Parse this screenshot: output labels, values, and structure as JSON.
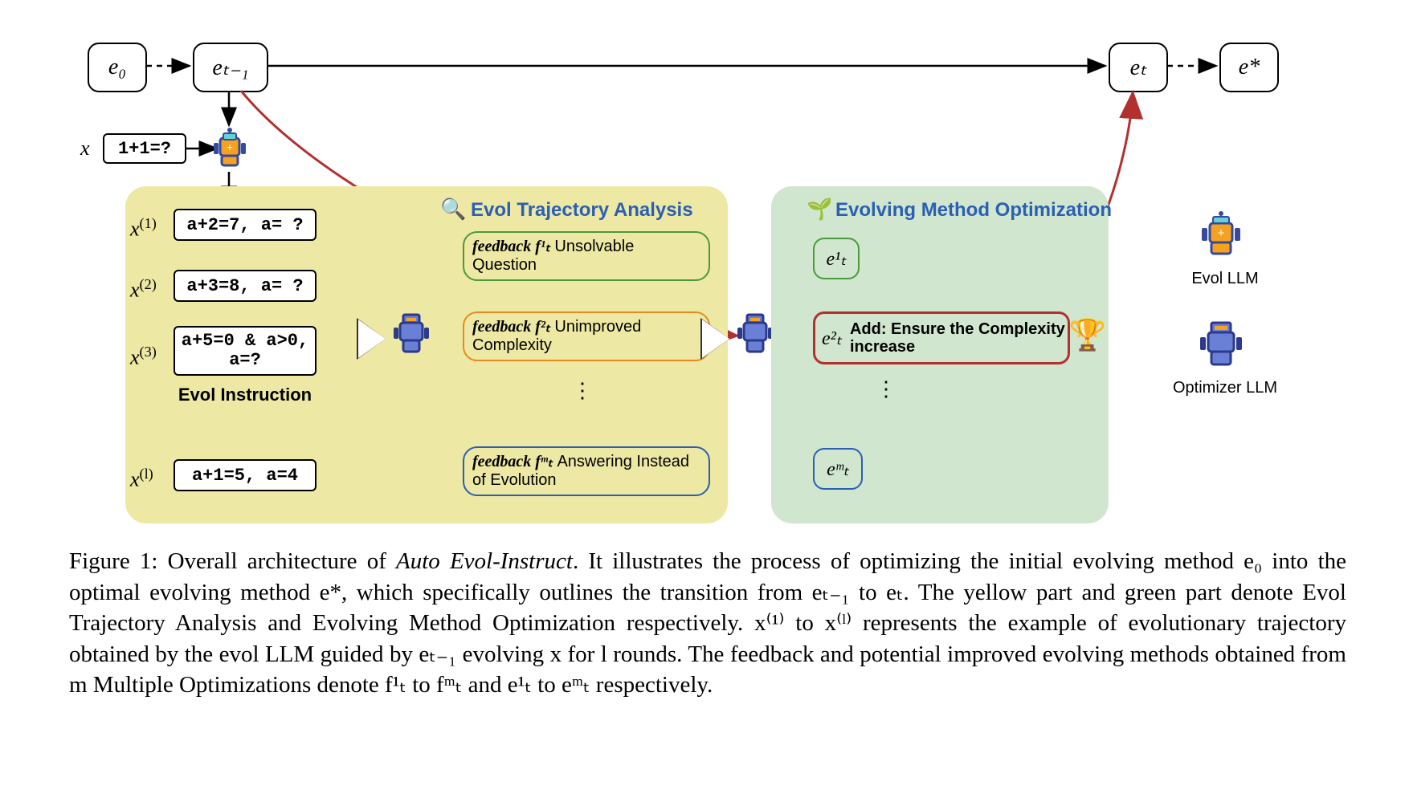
{
  "top_nodes": {
    "e0": "e₀",
    "etm1": "eₜ₋₁",
    "et": "eₜ",
    "estar": "e*"
  },
  "x_label": "x",
  "x_input": "1+1=?",
  "traj": {
    "x1": {
      "lab": "x⁽¹⁾",
      "val": "a+2=7, a= ?"
    },
    "x2": {
      "lab": "x⁽²⁾",
      "val": "a+3=8, a= ?"
    },
    "x3": {
      "lab": "x⁽³⁾",
      "val": "a+5=0 & a>0, a=?"
    },
    "xl": {
      "lab": "x⁽ˡ⁾",
      "val": "a+1=5, a=4"
    },
    "midtext": "Evol Instruction"
  },
  "panel1_title": "Evol Trajectory Analysis",
  "panel2_title": "Evolving Method Optimization",
  "feedback": {
    "f1": {
      "lab": "feedback f¹ₜ",
      "txt": "Unsolvable Question"
    },
    "f2": {
      "lab": "feedback f²ₜ",
      "txt": "Unimproved Complexity"
    },
    "fm": {
      "lab": "feedback fᵐₜ",
      "txt": "Answering Instead of Evolution"
    }
  },
  "evol_methods": {
    "e1": "e¹ₜ",
    "e2": {
      "lab": "e²ₜ",
      "txt": "Add: Ensure the Complexity increase"
    },
    "em": "eᵐₜ"
  },
  "legend": {
    "evol": "Evol LLM",
    "opt": "Optimizer LLM"
  },
  "caption": {
    "prefix": "Figure 1: Overall architecture of ",
    "name": "Auto Evol-Instruct",
    "body": ". It illustrates the process of optimizing the initial evolving method e₀ into the optimal evolving method e*, which specifically outlines the transition from eₜ₋₁ to eₜ. The yellow part and green part denote Evol Trajectory Analysis and Evolving Method Optimization respectively. x⁽¹⁾ to x⁽ˡ⁾ represents the example of evolutionary trajectory obtained by the evol LLM guided by eₜ₋₁ evolving x for l rounds. The feedback and potential improved evolving methods obtained from m Multiple Optimizations denote f¹ₜ to fᵐₜ and e¹ₜ to eᵐₜ respectively."
  }
}
